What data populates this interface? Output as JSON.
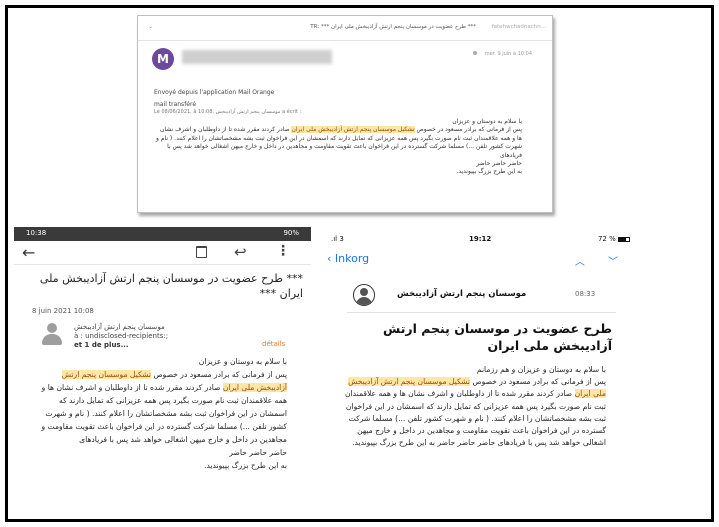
{
  "top_email": {
    "subject": "*** طرح عضویت در موسسان پنجم ارتش آزادیبخش ملی ایران *** :TR",
    "sender_right": "fatehwchadnachn...",
    "date": "mer. 9 juin à 10:04",
    "avatar_letter": "M",
    "line1": "Envoyé depuis l'application Mail Orange",
    "line2": "mail transféré",
    "line3": "Le 08/06/2021, à 10:08, موسسان پنجم ارتش آزادیبخش a écrit :",
    "body_greeting": "با سلام به دوستان و عزیزان",
    "body_before_hl": "پس از فرمانی که برادر مسعود در خصوص",
    "body_hl": "تشکیل موسسان پنجم ارتش آزادیبخش ملی ایران",
    "body_after_hl": "صادر کردند مقرر شده تا از داوطلبان و اشرف نشان ها و همه علاقمندان ثبت نام صورت بگیرد پس همه عزیزانی که تمایل دارند که اسمشان در این فراخوان ثبت بشه مشخصاتشان را اعلام کنند. ( نام و شهرت کشور تلفن ...) مسلما شرکت گسترده در این فراخوان باعث تقویت مقاومت و مجاهدین در داخل و خارج میهن اشغالی خواهد شد پس با فریادهای",
    "body_tail1": "حاضر حاضر حاضر",
    "body_tail2": "به این طرح بزرگ بپیوندید."
  },
  "android": {
    "status_time": "10:38",
    "status_right": "90%",
    "back_icon": "←",
    "reply_icon": "↩",
    "more_icon": "⋮",
    "subject": "*** طرح عضویت در موسسان پنجم ارتش آزادیبخش ملی ایران ***",
    "date": "8 juin 2021 10:08",
    "from_name": "موسسان پنجم ارتش آزادیبخش",
    "to": "à : undisclosed-recipients:;",
    "more_recipients": "et 1 de plus...",
    "details_label": "détails",
    "body_greeting": "با سلام به دوستان و عزیزان",
    "body_before_hl": "پس از فرمانی که برادر مسعود در خصوص",
    "body_hl": "تشکیل موسسان پنجم ارتش آزادیبخش ملی ایران",
    "body_after_hl": "صادر کردند مقرر شده تا از داوطلبان و اشرف نشان ها و همه علاقمندان ثبت نام صورت بگیرد پس همه عزیزانی که تمایل دارند که اسمشان در این فراخوان ثبت بشه مشخصاتشان را اعلام کنند. ( نام و شهرت کشور تلفن ...) مسلما شرکت گسترده در این فراخوان باعث تقویت مقاومت و مجاهدین در داخل و خارج میهن اشغالی خواهد شد پس با فریادهای",
    "body_tail1": "حاضر حاضر حاضر",
    "body_tail2": "به این طرح بزرگ بپیوندید."
  },
  "ios": {
    "signal": ".ıl 3",
    "time": "19:12",
    "battery": "72 %",
    "back_label": "‹ Inkorg",
    "chevrons": "︿ ﹀",
    "sender": "موسسان پنجم ارتش آزادیبخش",
    "msg_time": "08:33",
    "subject": "طرح عضویت در موسسان پنجم ارتش آزادیبخش ملی ایران",
    "body_greeting": "با سلام به دوستان و عزیزان و هم رزمانم",
    "body_before_hl": "پس از فرمانی که برادر مسعود در خصوص",
    "body_hl": "تشکیل موسسان پنجم ارتش آزادیبخش ملی ایران",
    "body_after_hl": "صادر کردند مقرر شده تا از داوطلبان و اشرف نشان ها و همه علاقمندان ثبت نام صورت بگیرد پس همه عزیزانی که تمایل دارند که اسمشان در این فراخوان ثبت بشه مشخصاتشان را اعلام کنند. ( نام و شهرت کشور تلفن ...) مسلما شرکت گسترده در این فراخوان باعث تقویت مقاومت و مجاهدین در داخل و خارج میهن اشغالی خواهد شد پس با فریادهای",
    "body_tail": "حاضر حاضر حاضر به این طرح بزرگ بپیوندید."
  },
  "colors": {
    "highlight_bg": "#fde6a8",
    "highlight_text": "#9a4d00",
    "ios_blue": "#1a73e8",
    "android_accent": "#e07a2b"
  }
}
